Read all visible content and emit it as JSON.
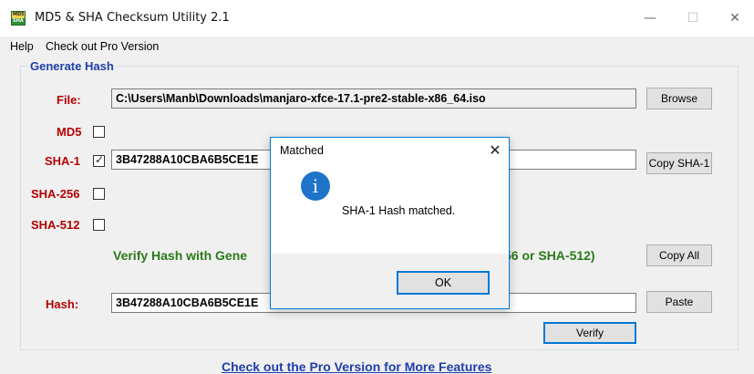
{
  "window": {
    "title": "MD5 & SHA Checksum Utility 2.1",
    "icon_top": "MD5",
    "icon_bottom": "SHA",
    "minimize": "—",
    "maximize": "☐",
    "close": "✕"
  },
  "menu": {
    "help": "Help",
    "pro": "Check out Pro Version"
  },
  "generate": {
    "group_title": "Generate Hash",
    "file_label": "File:",
    "file_value": "C:\\Users\\Manb\\Downloads\\manjaro-xfce-17.1-pre2-stable-x86_64.iso",
    "browse_label": "Browse",
    "md5_label": "MD5",
    "md5_checked": false,
    "sha1_label": "SHA-1",
    "sha1_checked": true,
    "sha1_value": "3B47288A10CBA6B5CE1E",
    "copy_sha1_label": "Copy SHA-1",
    "sha256_label": "SHA-256",
    "sha256_checked": false,
    "sha512_label": "SHA-512",
    "sha512_checked": false,
    "copy_all_label": "Copy All"
  },
  "verify": {
    "title_visible_start": "Verify Hash with Gene",
    "title_visible_end": "56 or SHA-512)",
    "hash_label": "Hash:",
    "hash_value": "3B47288A10CBA6B5CE1E",
    "paste_label": "Paste",
    "verify_label": "Verify"
  },
  "footer": {
    "link": "Check out the Pro Version for More Features"
  },
  "dialog": {
    "title": "Matched",
    "close": "✕",
    "message": "SHA-1 Hash matched.",
    "ok_label": "OK",
    "icon": "info-icon"
  },
  "colors": {
    "label_red": "#b40000",
    "title_blue": "#1f3ea8",
    "verify_green": "#2a7a1a",
    "focus_blue": "#0078d7"
  }
}
